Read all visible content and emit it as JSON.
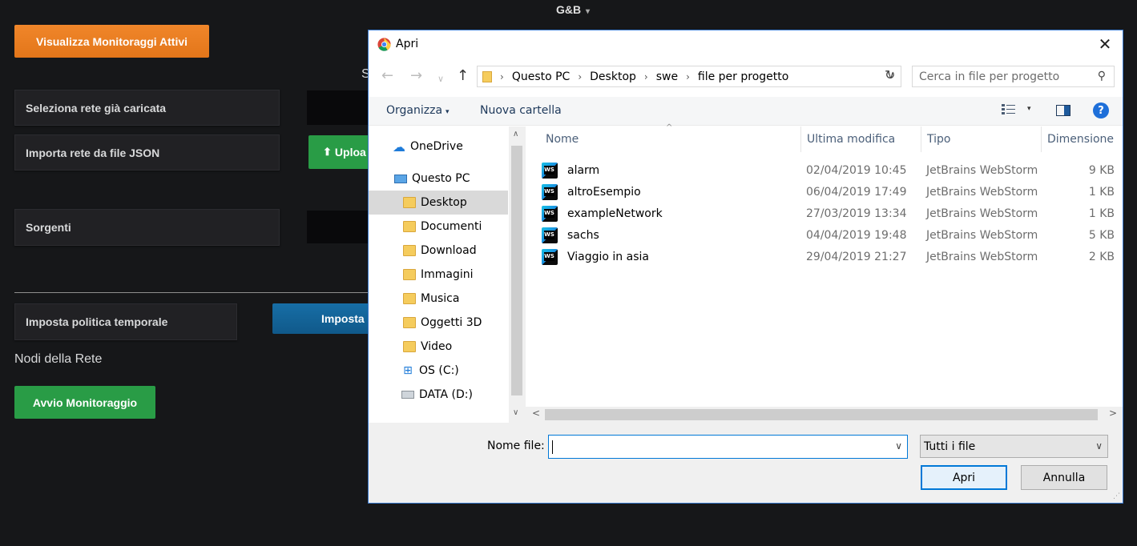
{
  "app": {
    "title": "G&B",
    "title_caret": "▾",
    "partial_heading": "S",
    "buttons": {
      "active_monitorings": "Visualizza Monitoraggi Attivi",
      "upload": "Uploa",
      "set_policy": "Imposta",
      "start_monitoring": "Avvio Monitoraggio"
    },
    "labels": {
      "select_network": "Seleziona rete già caricata",
      "import_json": "Importa rete da file JSON",
      "sources": "Sorgenti",
      "time_policy": "Imposta politica temporale",
      "network_nodes": "Nodi della Rete"
    },
    "upload_icon": "upload-icon"
  },
  "dialog": {
    "title": "Apri",
    "close_glyph": "✕",
    "nav": {
      "back": "←",
      "forward": "→",
      "recent": "∨",
      "up": "↑",
      "breadcrumb": [
        "Questo PC",
        "Desktop",
        "swe",
        "file per progetto"
      ],
      "sep": "›",
      "addr_dropdown": "∨",
      "refresh": "↻"
    },
    "search": {
      "placeholder": "Cerca in file per progetto",
      "icon": "⚲"
    },
    "toolbar": {
      "organize": "Organizza",
      "organize_caret": "▾",
      "new_folder": "Nuova cartella",
      "view_caret": "▾",
      "help": "?"
    },
    "tree": {
      "items": [
        {
          "label": "OneDrive",
          "icon": "cloud-icon"
        },
        {
          "label": "Questo PC",
          "icon": "pc-icon"
        },
        {
          "label": "Desktop",
          "icon": "folder-icon",
          "selected": true
        },
        {
          "label": "Documenti",
          "icon": "folder-icon"
        },
        {
          "label": "Download",
          "icon": "folder-icon"
        },
        {
          "label": "Immagini",
          "icon": "folder-icon"
        },
        {
          "label": "Musica",
          "icon": "folder-icon"
        },
        {
          "label": "Oggetti 3D",
          "icon": "folder-icon"
        },
        {
          "label": "Video",
          "icon": "folder-icon"
        },
        {
          "label": "OS (C:)",
          "icon": "windows-drive-icon"
        },
        {
          "label": "DATA (D:)",
          "icon": "drive-icon"
        }
      ],
      "scroll_up": "∧",
      "scroll_down": "∨"
    },
    "columns": {
      "name": "Nome",
      "modified": "Ultima modifica",
      "type": "Tipo",
      "size": "Dimensione",
      "sort_arrow": "^"
    },
    "files": [
      {
        "name": "alarm",
        "modified": "02/04/2019 10:45",
        "type": "JetBrains WebStorm",
        "size": "9 KB"
      },
      {
        "name": "altroEsempio",
        "modified": "06/04/2019 17:49",
        "type": "JetBrains WebStorm",
        "size": "1 KB"
      },
      {
        "name": "exampleNetwork",
        "modified": "27/03/2019 13:34",
        "type": "JetBrains WebStorm",
        "size": "1 KB"
      },
      {
        "name": "sachs",
        "modified": "04/04/2019 19:48",
        "type": "JetBrains WebStorm",
        "size": "5 KB"
      },
      {
        "name": "Viaggio in asia",
        "modified": "29/04/2019 21:27",
        "type": "JetBrains WebStorm",
        "size": "2 KB"
      }
    ],
    "hscroll": {
      "left": "<",
      "right": ">"
    },
    "footer": {
      "filename_label": "Nome file:",
      "filename_value": "",
      "filename_dropdown": "∨",
      "filter": "Tutti i file",
      "filter_dropdown": "∨",
      "open": "Apri",
      "cancel": "Annulla"
    }
  }
}
